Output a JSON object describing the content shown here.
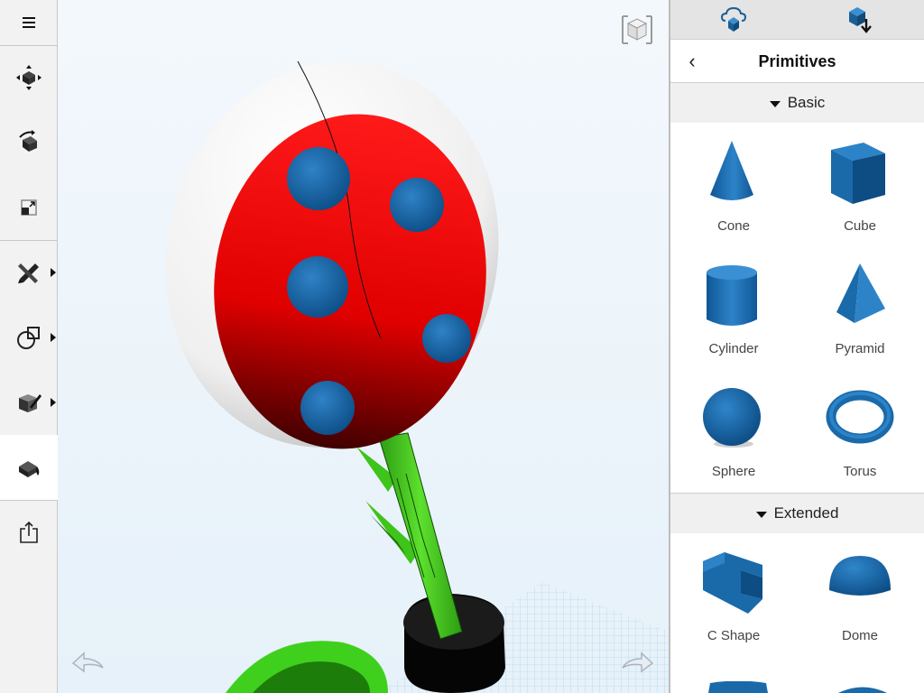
{
  "toolbar": {
    "items": [
      {
        "name": "menu-button",
        "icon": "hamburger-icon"
      },
      {
        "name": "transform-tool",
        "icon": "transform-icon"
      },
      {
        "name": "rotate-tool",
        "icon": "rotate-icon"
      },
      {
        "name": "scale-tool",
        "icon": "scale-icon"
      },
      {
        "name": "sketch-tool",
        "icon": "pencil-ruler-icon"
      },
      {
        "name": "primitives-tool",
        "icon": "shapes-icon"
      },
      {
        "name": "modify-tool",
        "icon": "edit-box-icon"
      },
      {
        "name": "material-tool",
        "icon": "paint-bucket-icon"
      },
      {
        "name": "export-tool",
        "icon": "share-icon"
      }
    ]
  },
  "panel": {
    "title": "Primitives",
    "back_label": "‹",
    "tabs": [
      {
        "icon": "cloud-icon"
      },
      {
        "icon": "download-box-icon"
      }
    ],
    "sections": [
      {
        "title": "Basic",
        "items": [
          {
            "label": "Cone",
            "icon": "cone-icon"
          },
          {
            "label": "Cube",
            "icon": "cube-icon"
          },
          {
            "label": "Cylinder",
            "icon": "cylinder-icon"
          },
          {
            "label": "Pyramid",
            "icon": "pyramid-icon"
          },
          {
            "label": "Sphere",
            "icon": "sphere-icon"
          },
          {
            "label": "Torus",
            "icon": "torus-icon"
          }
        ]
      },
      {
        "title": "Extended",
        "items": [
          {
            "label": "C Shape",
            "icon": "c-shape-icon"
          },
          {
            "label": "Dome",
            "icon": "dome-icon"
          }
        ]
      }
    ]
  },
  "colors": {
    "primitive_blue": "#1565a8",
    "plant_head_red": "#ff0000",
    "stem_green": "#3fbf1a"
  }
}
